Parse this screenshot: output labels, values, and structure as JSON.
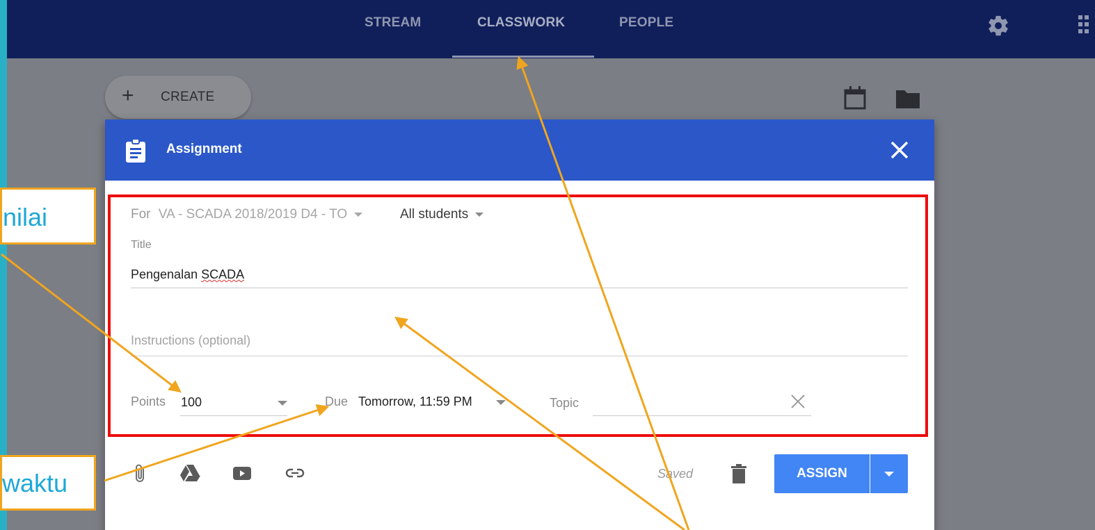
{
  "nav": {
    "tabs": [
      {
        "label": "STREAM"
      },
      {
        "label": "CLASSWORK",
        "active": true
      },
      {
        "label": "PEOPLE"
      }
    ],
    "icons": [
      "gear-icon",
      "apps-grid-icon"
    ]
  },
  "toolbar": {
    "create_label": "CREATE",
    "icons": [
      "calendar-icon",
      "folder-icon"
    ]
  },
  "dialog": {
    "title": "Assignment",
    "for_prefix": "For",
    "class_name": "VA - SCADA 2018/2019 D4 - TO",
    "audience": "All students",
    "title_label": "Title",
    "title_value_prefix": "Pengenalan ",
    "title_value_misspelled": "SCADA",
    "instructions_placeholder": "Instructions (optional)",
    "points_label": "Points",
    "points_value": "100",
    "due_label": "Due",
    "due_value": "Tomorrow, 11:59 PM",
    "topic_label": "Topic",
    "saved_text": "Saved",
    "assign_label": "ASSIGN",
    "footer_icons": [
      "attachment-icon",
      "google-drive-icon",
      "youtube-icon",
      "link-icon",
      "trash-icon"
    ]
  },
  "callouts": {
    "nilai": "nilai",
    "waktu": "waktu"
  },
  "colors": {
    "topbar": "#101f5a",
    "dialog_header": "#2b57c9",
    "assign_button": "#4285f4",
    "highlight_box": "#ee0c0c",
    "arrow": "#f0a51e",
    "callout_text": "#1da8d6",
    "slide_background": "#2ab0c6"
  }
}
